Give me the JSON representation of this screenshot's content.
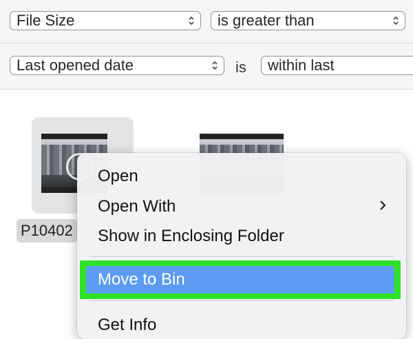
{
  "rules": [
    {
      "attribute": "File Size",
      "operator": "is greater than"
    },
    {
      "attribute": "Last opened date",
      "connector": "is",
      "operator": "within last"
    }
  ],
  "files": [
    {
      "name": "P10402"
    }
  ],
  "context_menu": {
    "items": [
      "Open",
      "Open With",
      "Show in Enclosing Folder",
      "Move to Bin",
      "Get Info"
    ],
    "highlighted": "Move to Bin",
    "highlight_color": "#5b9cf2",
    "annotation_color": "#2fe227"
  },
  "icons": {
    "popup": "up-down-chevron-icon",
    "submenu": "chevron-right-icon",
    "play": "play-circle-icon"
  }
}
